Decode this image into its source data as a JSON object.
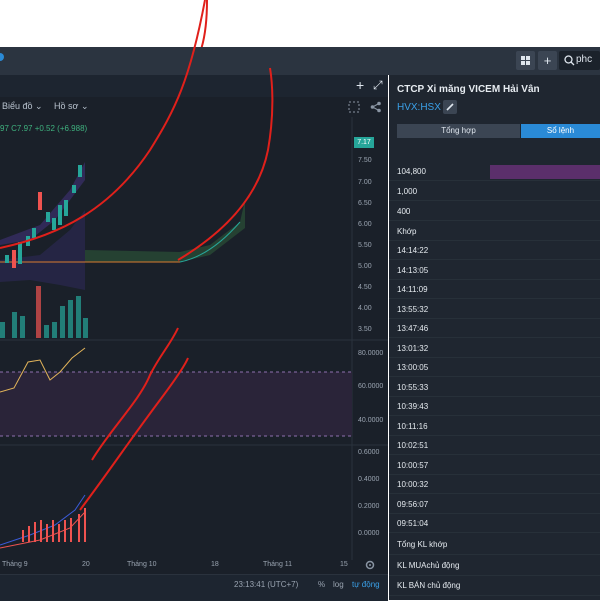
{
  "topbar": {
    "add_label": "+",
    "search_value": "phc"
  },
  "chart_toolbar": {
    "plus_label": "+",
    "expand_label": "⤢",
    "chart_type_label": "Biểu đồ",
    "save_label": "Hồ sơ"
  },
  "legend_text": "97 C7.97 +0.52 (+6.988)",
  "price_tag": "7.17",
  "price_axis": [
    "7.50",
    "7.00",
    "6.50",
    "6.00",
    "5.50",
    "5.00",
    "4.50",
    "4.00",
    "3.50"
  ],
  "rsi_axis": [
    "80.0000",
    "60.0000",
    "40.0000"
  ],
  "macd_axis": [
    "0.6000",
    "0.4000",
    "0.2000",
    "0.0000"
  ],
  "x_axis": [
    "Tháng 9",
    "20",
    "Tháng 10",
    "18",
    "Tháng 11",
    "15"
  ],
  "bottom_bar": {
    "time": "23:13:41 (UTC+7)",
    "percent": "%",
    "log": "log",
    "auto": "tự động"
  },
  "panel": {
    "title": "CTCP Xi măng VICEM Hải Vân",
    "ticker": "HVX:HSX",
    "tabs": [
      "Tổng hợp",
      "Sổ lệnh"
    ],
    "volumes": [
      "104,800",
      "1,000",
      "400"
    ],
    "match_label": "Khớp",
    "times": [
      "14:14:22",
      "14:13:05",
      "14:11:09",
      "13:55:32",
      "13:47:46",
      "13:01:32",
      "13:00:05",
      "10:55:33",
      "10:39:43",
      "10:11:16",
      "10:02:51",
      "10:00:57",
      "10:00:32",
      "09:56:07",
      "09:51:04"
    ],
    "summary": [
      "Tổng KL khớp",
      "KL MUAchủ động",
      "KL BÁN chủ động"
    ]
  },
  "colors": {
    "up": "#26a69a",
    "down": "#ef5350",
    "accent": "#2a8ad6",
    "annotation": "#e0201b"
  }
}
